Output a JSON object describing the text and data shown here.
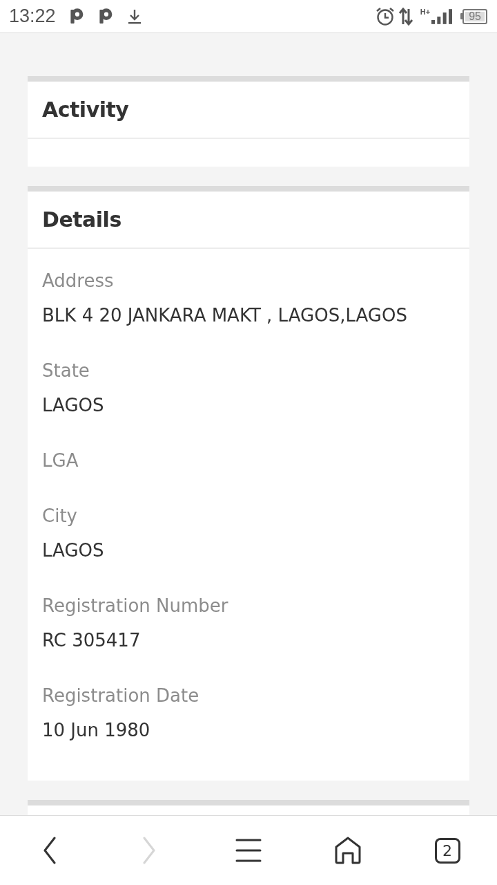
{
  "status_bar": {
    "time": "13:22",
    "network": "H+",
    "battery": "95"
  },
  "cards": [
    {
      "title": "Activity"
    },
    {
      "title": "Details",
      "fields": [
        {
          "label": "Address",
          "value": "BLK 4 20 JANKARA MAKT , LAGOS,LAGOS"
        },
        {
          "label": "State",
          "value": "LAGOS"
        },
        {
          "label": "LGA"
        },
        {
          "label": "City",
          "value": "LAGOS"
        },
        {
          "label": "Registration Number",
          "value": "RC 305417"
        },
        {
          "label": "Registration Date",
          "value": "10 Jun 1980"
        }
      ]
    }
  ],
  "bottom_nav": [
    {
      "kind": "back",
      "disabled": false
    },
    {
      "kind": "forward",
      "disabled": true
    },
    {
      "kind": "menu",
      "disabled": false
    },
    {
      "kind": "home",
      "disabled": false
    },
    {
      "kind": "tabs",
      "count": "2",
      "disabled": false
    }
  ]
}
